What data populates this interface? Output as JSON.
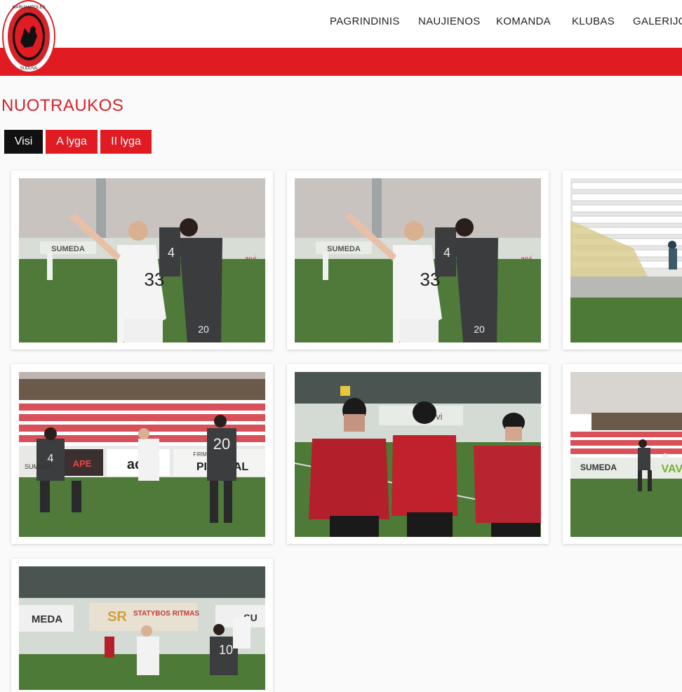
{
  "site": {
    "logo_text_top": "MARIJAMPOLĖS",
    "logo_text_bottom": "SŪDUVA"
  },
  "nav": [
    "PAGRINDINIS",
    "NAUJIENOS",
    "KOMANDA",
    "KLUBAS",
    "GALERIJOS"
  ],
  "page": {
    "title": "NUOTRAUKOS"
  },
  "filters": [
    {
      "label": "Visi",
      "active": true
    },
    {
      "label": "A lyga",
      "active": false
    },
    {
      "label": "II lyga",
      "active": false
    }
  ],
  "photos": [
    {
      "name": "photo-players-arguing",
      "signs": [
        "SUMEDA",
        "arvi"
      ],
      "numbers": [
        "33",
        "4",
        "20"
      ]
    },
    {
      "name": "photo-players-arguing-duplicate",
      "signs": [
        "SUMEDA",
        "arvi"
      ],
      "numbers": [
        "33",
        "4",
        "20"
      ]
    },
    {
      "name": "photo-empty-stands",
      "signs": [],
      "numbers": []
    },
    {
      "name": "photo-match-action",
      "signs": [
        "SUMEDA",
        "APE",
        "ac",
        "PIRO VAL",
        "FIRM"
      ],
      "numbers": [
        "4",
        "20"
      ]
    },
    {
      "name": "photo-coaches-red-jackets",
      "signs": [
        "arvi"
      ],
      "numbers": []
    },
    {
      "name": "photo-player-dribbling",
      "signs": [
        "SUMEDA",
        "VAVA"
      ],
      "numbers": []
    },
    {
      "name": "photo-rainy-match",
      "signs": [
        "MEDA",
        "SR",
        "STATYBOS RITMAS",
        "SU"
      ],
      "numbers": [
        "10"
      ]
    }
  ]
}
